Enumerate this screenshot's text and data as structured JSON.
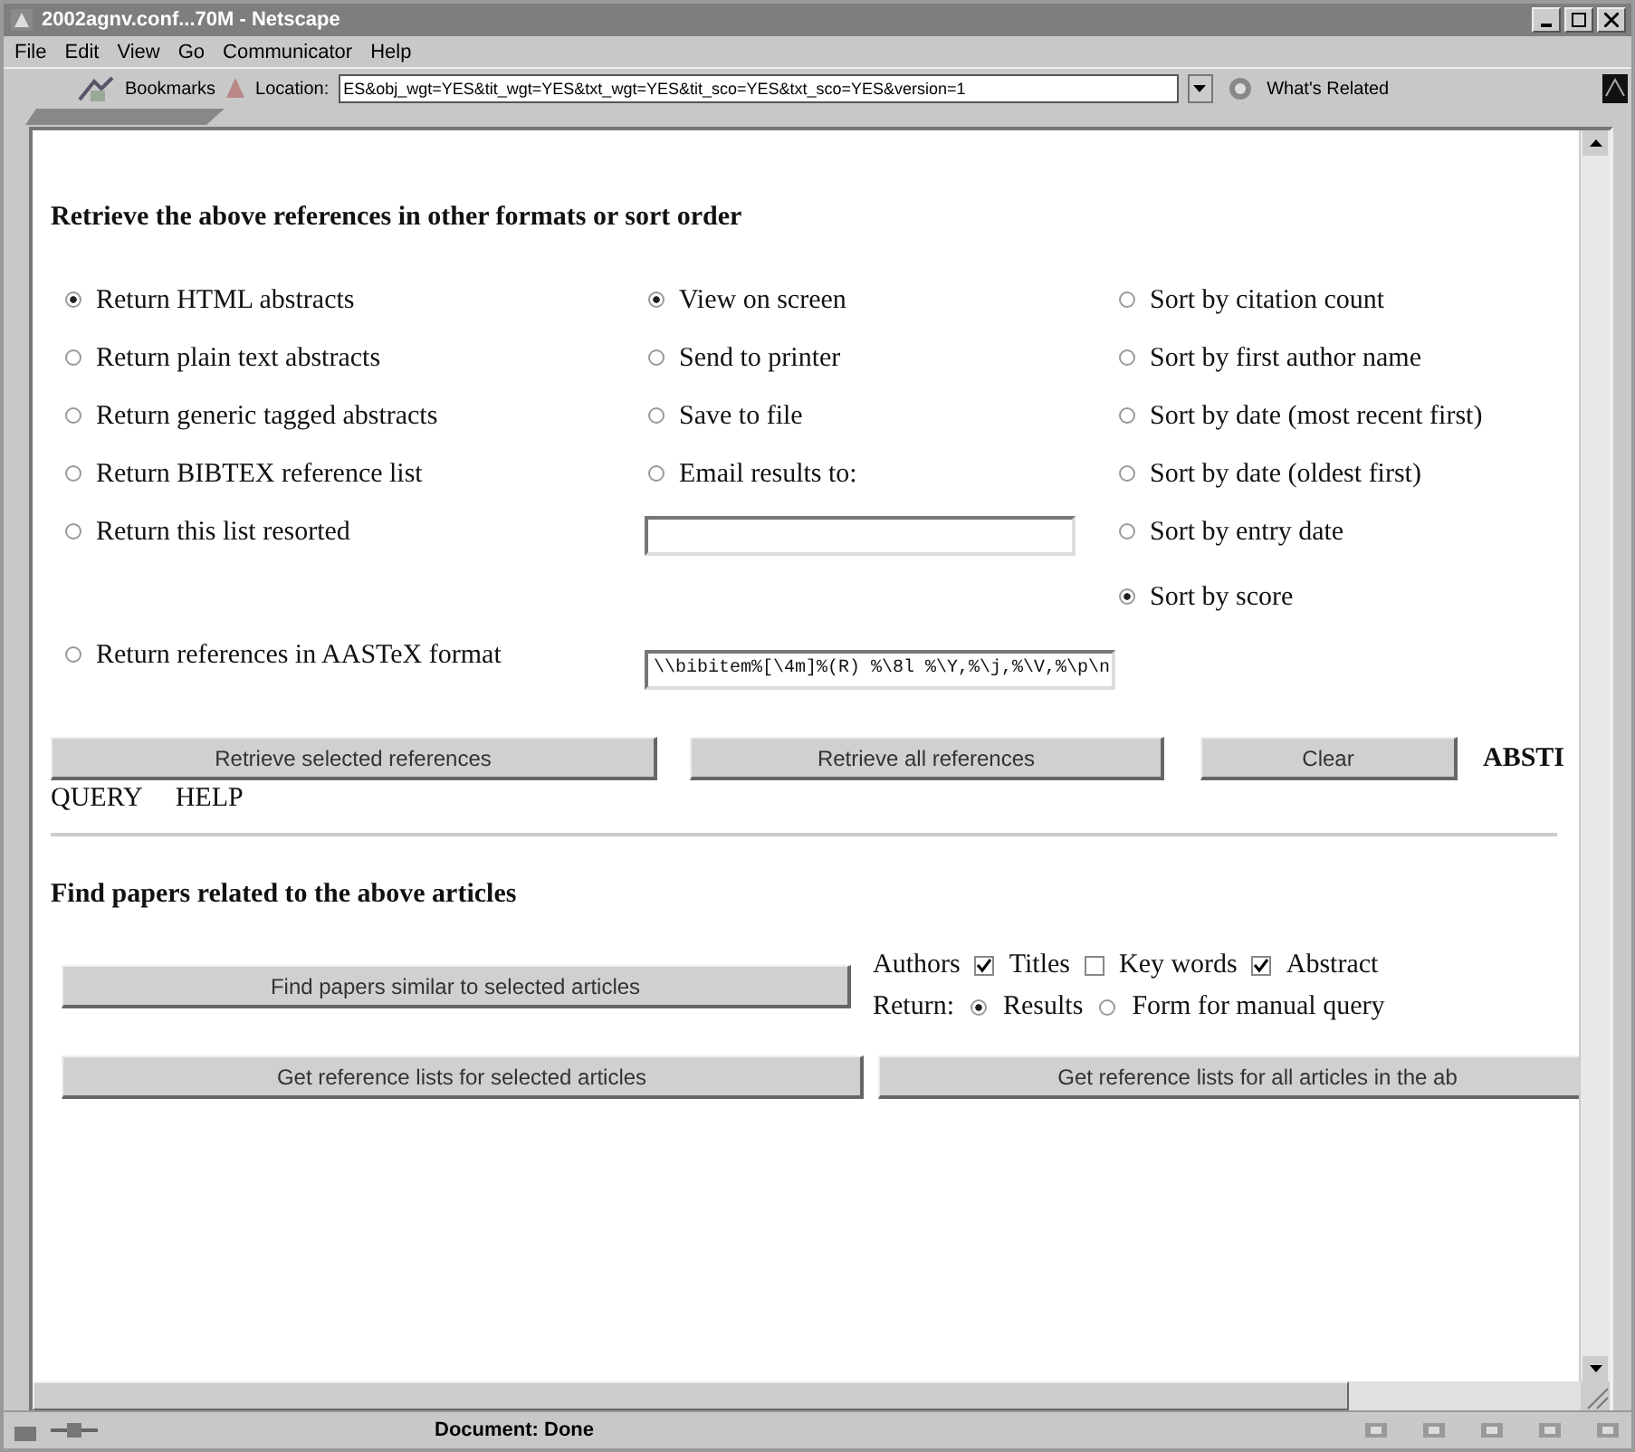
{
  "window": {
    "title": "2002agnv.conf...70M - Netscape"
  },
  "menu": [
    "File",
    "Edit",
    "View",
    "Go",
    "Communicator",
    "Help"
  ],
  "toolbar": {
    "bookmarks": "Bookmarks",
    "location_label": "Location:",
    "location": "ES&obj_wgt=YES&tit_wgt=YES&txt_wgt=YES&tit_sco=YES&txt_sco=YES&version=1",
    "related": "What's Related"
  },
  "retrieve": {
    "heading": "Retrieve the above references in other formats or sort order",
    "rows": [
      [
        {
          "kind": "radio",
          "label": "Return HTML abstracts",
          "selected": true
        },
        {
          "kind": "radio",
          "label": "View on screen",
          "selected": true
        },
        {
          "kind": "radio",
          "label": "Sort by citation count",
          "selected": false
        }
      ],
      [
        {
          "kind": "radio",
          "label": "Return plain text abstracts",
          "selected": false
        },
        {
          "kind": "radio",
          "label": "Send to printer",
          "selected": false
        },
        {
          "kind": "radio",
          "label": "Sort by first author name",
          "selected": false
        }
      ],
      [
        {
          "kind": "radio",
          "label": "Return generic tagged abstracts",
          "selected": false
        },
        {
          "kind": "radio",
          "label": "Save to file",
          "selected": false
        },
        {
          "kind": "radio",
          "label": "Sort by date (most recent first)",
          "selected": false
        }
      ],
      [
        {
          "kind": "radio",
          "label": "Return BIBTEX reference list",
          "selected": false
        },
        {
          "kind": "radio",
          "label": "Email results to:",
          "selected": false
        },
        {
          "kind": "radio",
          "label": "Sort by date (oldest first)",
          "selected": false
        }
      ],
      [
        {
          "kind": "radio",
          "label": "Return this list resorted",
          "selected": false
        },
        {
          "kind": "field"
        },
        {
          "kind": "radio",
          "label": "Sort by entry date",
          "selected": false
        }
      ],
      [
        {
          "kind": "empty"
        },
        {
          "kind": "empty"
        },
        {
          "kind": "radio",
          "label": "Sort by score",
          "selected": true
        }
      ],
      [
        {
          "kind": "radio",
          "label": "Return references in AASTeX format",
          "selected": false
        },
        {
          "kind": "field",
          "value": "\\\\bibitem%[\\4m]%(R) %\\8l %\\Y,%\\j,%\\V,%\\p\\n"
        },
        {
          "kind": "empty"
        }
      ]
    ],
    "buttons": [
      "Retrieve selected references",
      "Retrieve all references",
      "Clear"
    ],
    "links": [
      "ABSTI",
      "QUERY",
      "HELP"
    ]
  },
  "related": {
    "heading": "Find papers related to the above articles",
    "find_button": "Find papers similar to selected articles",
    "criteria": [
      {
        "kind": "text",
        "label": "Authors"
      },
      {
        "kind": "checkbox",
        "checked": true
      },
      {
        "kind": "text",
        "label": "Titles"
      },
      {
        "kind": "checkbox",
        "checked": false
      },
      {
        "kind": "text",
        "label": "Key words"
      },
      {
        "kind": "checkbox",
        "checked": true
      },
      {
        "kind": "text",
        "label": "Abstract"
      }
    ],
    "return_label": "Return:",
    "return_options": [
      {
        "label": "Results",
        "selected": true
      },
      {
        "label": "Form for manual query",
        "selected": false
      }
    ],
    "buttons": [
      "Get reference lists for selected articles",
      "Get reference lists for all articles in the ab"
    ]
  },
  "status_bar": {
    "text": "Document: Done"
  }
}
